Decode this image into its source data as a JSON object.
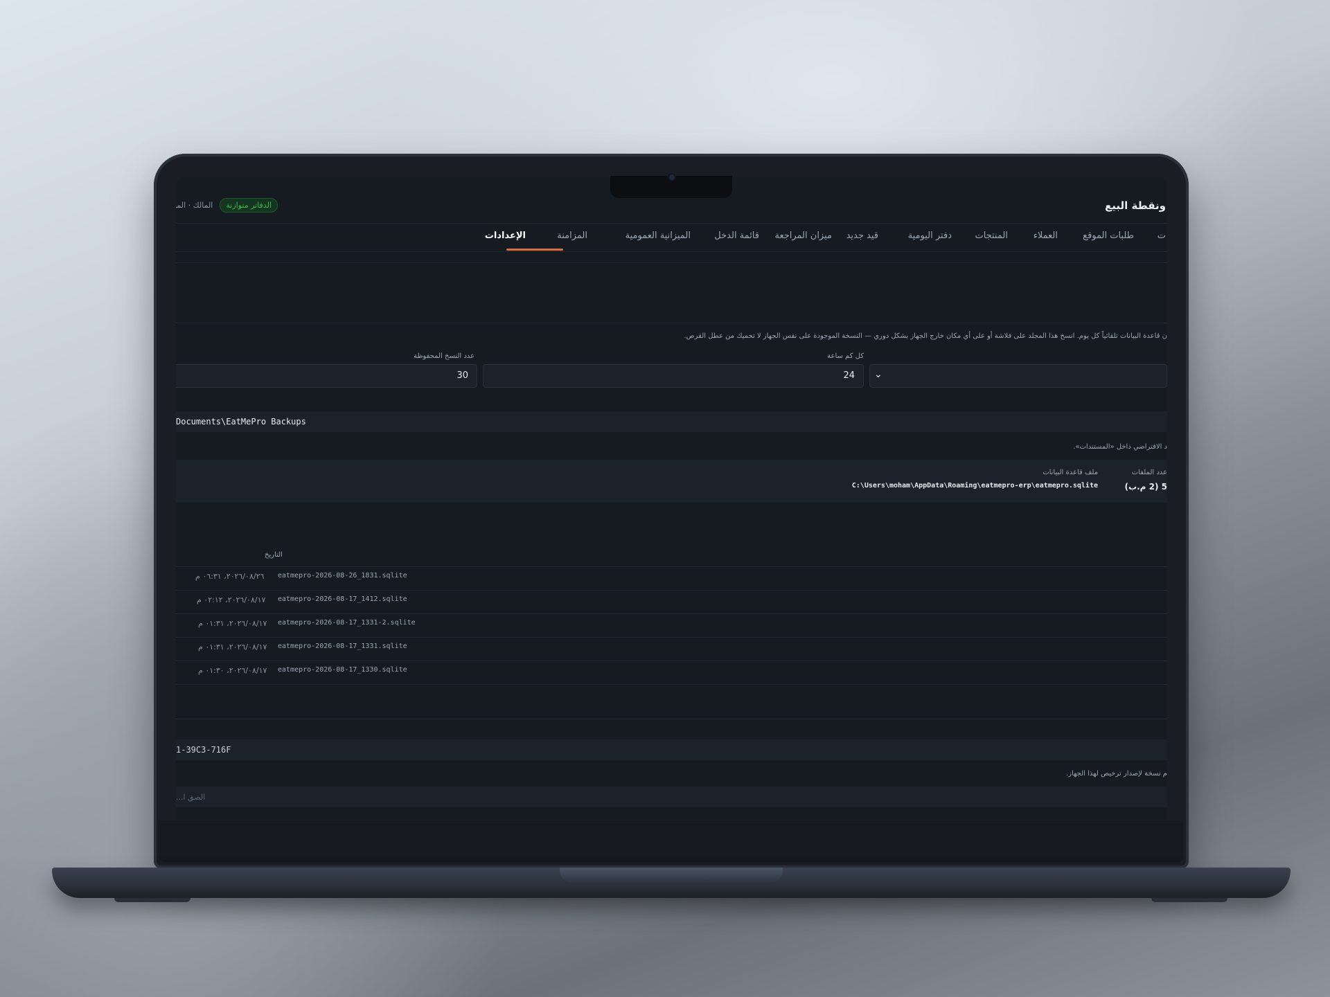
{
  "app": {
    "title": "ونقطة البيع",
    "ledger_badge": "الدفاتر متوازنة",
    "user_role": "المالك · الما"
  },
  "tabs": [
    {
      "label": "ت"
    },
    {
      "label": "طلبات الموقع"
    },
    {
      "label": "العملاء"
    },
    {
      "label": "المنتجات"
    },
    {
      "label": "دفتر اليومية"
    },
    {
      "label": "قيد جديد"
    },
    {
      "label": "ميزان المراجعة"
    },
    {
      "label": "قائمة الدخل"
    },
    {
      "label": "الميزانية العمومية"
    },
    {
      "label": "المزامنة"
    },
    {
      "label": "الإعدادات",
      "active": true
    }
  ],
  "backup": {
    "description": "ن قاعدة البيانات تلقائياً كل يوم. انسخ هذا المجلد على فلاشة أو على أي مكان خارج الجهاز بشكل دوري — النسخة الموجودة على نفس الجهاز لا تحميك من عطل القرص.",
    "every_hours_label": "كل كم ساعة",
    "every_hours_value": "24",
    "kept_copies_label": "عدد النسخ المحفوظة",
    "kept_copies_value": "30",
    "folder_path": "Documents\\EatMePro Backups",
    "folder_hint": "د الافتراضي داخل «المستندات».",
    "files_count_label": "عدد الملفات",
    "files_count_value": "5 (2 م.ب)",
    "db_file_label": "ملف قاعدة البيانات",
    "db_file_value": "C:\\Users\\moham\\AppData\\Roaming\\eatmepro-erp\\eatmepro.sqlite"
  },
  "backups_table": {
    "date_header": "التاريخ",
    "rows": [
      {
        "file": "eatmepro-2026-08-26_1831.sqlite",
        "date": "٢٠٢٦/٠٨/٢٦، ٠٦:٣١ م"
      },
      {
        "file": "eatmepro-2026-08-17_1412.sqlite",
        "date": "٢٠٢٦/٠٨/١٧، ٠٢:١٢ م"
      },
      {
        "file": "eatmepro-2026-08-17_1331-2.sqlite",
        "date": "٢٠٢٦/٠٨/١٧، ٠١:٣١ م"
      },
      {
        "file": "eatmepro-2026-08-17_1331.sqlite",
        "date": "٢٠٢٦/٠٨/١٧، ٠١:٣١ م"
      },
      {
        "file": "eatmepro-2026-08-17_1330.sqlite",
        "date": "٢٠٢٦/٠٨/١٧، ٠١:٣٠ م"
      }
    ]
  },
  "license": {
    "device_id": "1-39C3-716F",
    "hint": "م نسخة لإصدار ترخيص لهذا الجهاز.",
    "paste_placeholder": "الصق ا..."
  }
}
